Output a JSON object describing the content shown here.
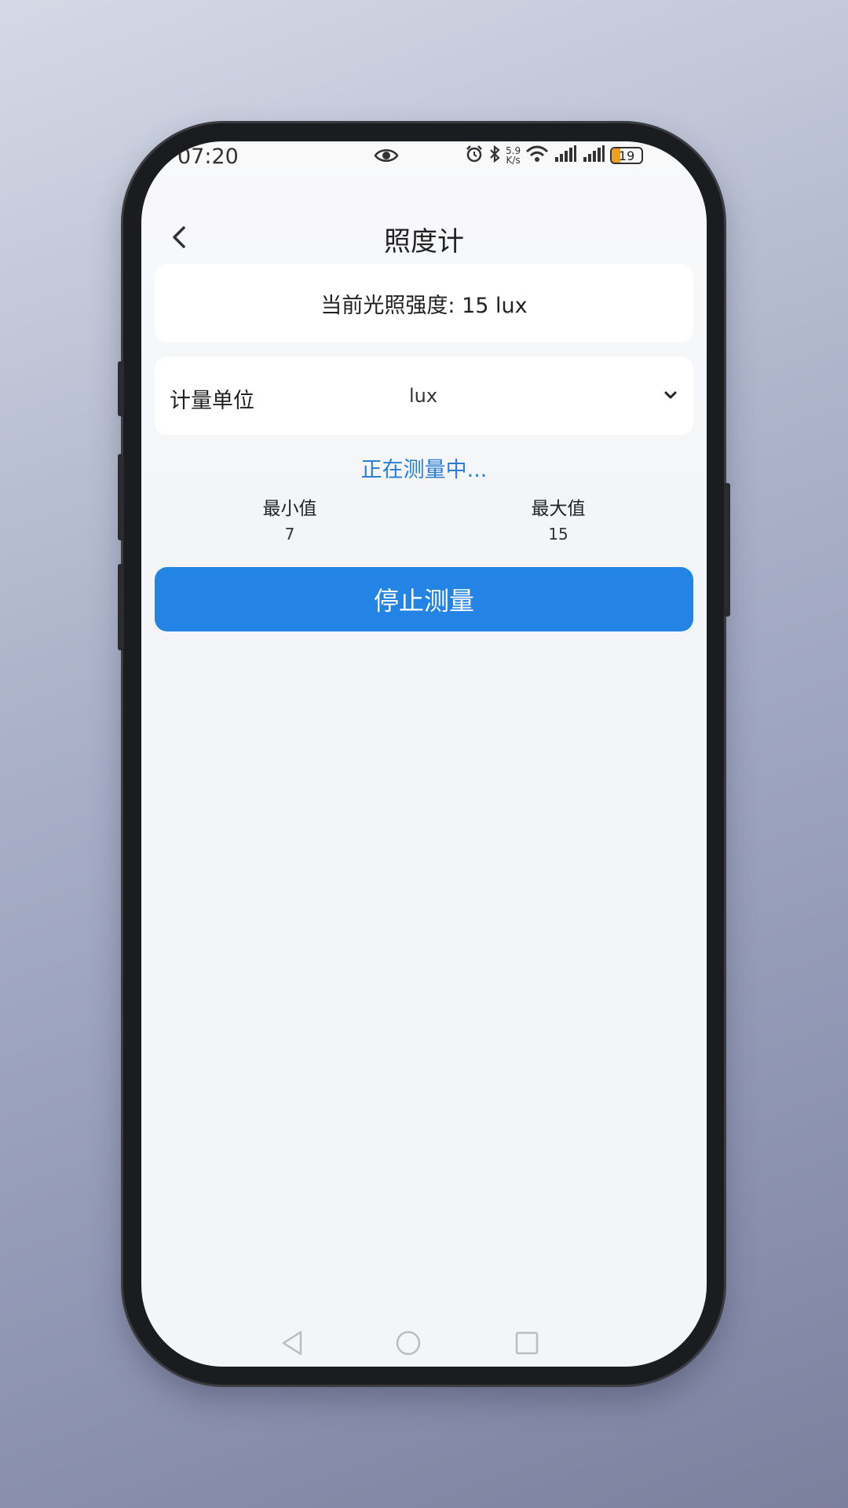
{
  "status_bar": {
    "time": "07:20",
    "net_speed_value": "5.9",
    "net_speed_unit": "K/s",
    "battery": "19",
    "icons": [
      "eye-icon",
      "alarm-icon",
      "bluetooth-icon",
      "wifi-icon",
      "signal-icon",
      "signal-icon",
      "battery-icon"
    ]
  },
  "header": {
    "title": "照度计"
  },
  "reading": {
    "text": "当前光照强度: 15 lux"
  },
  "unit": {
    "label": "计量单位",
    "selected": "lux"
  },
  "status": {
    "text": "正在测量中..."
  },
  "stats": {
    "min_label": "最小值",
    "min_value": "7",
    "max_label": "最大值",
    "max_value": "15"
  },
  "action": {
    "stop_label": "停止测量"
  },
  "colors": {
    "accent": "#2384e6",
    "status_text": "#2a7fd4",
    "battery": "#f0a020"
  }
}
